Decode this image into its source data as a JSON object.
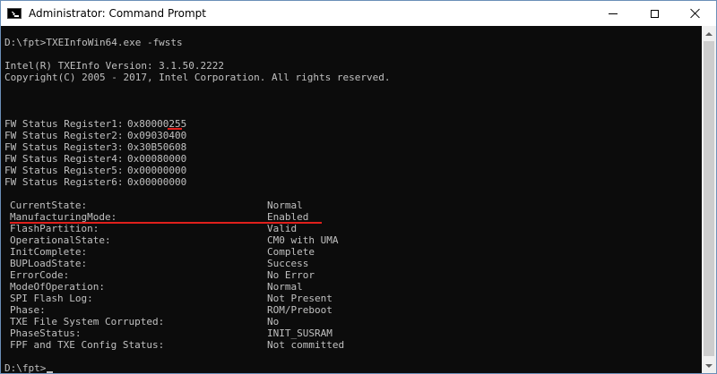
{
  "window": {
    "title": "Administrator: Command Prompt"
  },
  "console": {
    "command_line": "D:\\fpt>TXEInfoWin64.exe -fwsts",
    "version_line": "Intel(R) TXEInfo Version: 3.1.50.2222",
    "copyright_line": "Copyright(C) 2005 - 2017, Intel Corporation. All rights reserved.",
    "registers": [
      {
        "name": "FW Status Register1:",
        "value": "0x80000255"
      },
      {
        "name": "FW Status Register2:",
        "value": "0x09030400"
      },
      {
        "name": "FW Status Register3:",
        "value": "0x30B50608"
      },
      {
        "name": "FW Status Register4:",
        "value": "0x00080000"
      },
      {
        "name": "FW Status Register5:",
        "value": "0x00000000"
      },
      {
        "name": "FW Status Register6:",
        "value": "0x00000000"
      }
    ],
    "status": [
      {
        "key": "CurrentState:",
        "value": "Normal"
      },
      {
        "key": "ManufacturingMode:",
        "value": "Enabled"
      },
      {
        "key": "FlashPartition:",
        "value": "Valid"
      },
      {
        "key": "OperationalState:",
        "value": "CM0 with UMA"
      },
      {
        "key": "InitComplete:",
        "value": "Complete"
      },
      {
        "key": "BUPLoadState:",
        "value": "Success"
      },
      {
        "key": "ErrorCode:",
        "value": "No Error"
      },
      {
        "key": "ModeOfOperation:",
        "value": "Normal"
      },
      {
        "key": "SPI Flash Log:",
        "value": "Not Present"
      },
      {
        "key": "Phase:",
        "value": "ROM/Preboot"
      },
      {
        "key": "TXE File System Corrupted:",
        "value": "No"
      },
      {
        "key": "PhaseStatus:",
        "value": "INIT_SUSRAM"
      },
      {
        "key": "FPF and TXE Config Status:",
        "value": "Not committed"
      }
    ],
    "prompt": "D:\\fpt>"
  },
  "colors": {
    "console_bg": "#0c0c0c",
    "console_fg": "#c0c0c0",
    "annotation": "#e0201c"
  },
  "icons": {
    "app": "cmd-icon",
    "minimize": "minimize-icon",
    "maximize": "maximize-icon",
    "close": "close-icon"
  }
}
